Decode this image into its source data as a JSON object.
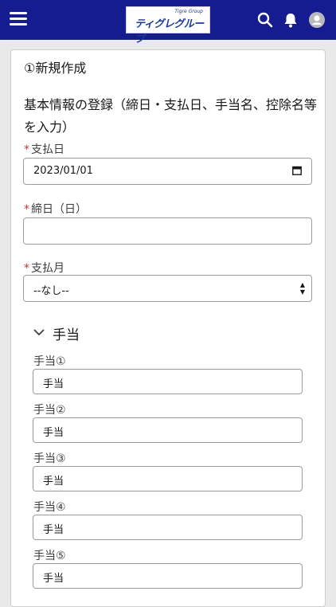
{
  "header": {
    "logo_tag": "Tigre Group",
    "logo_text": "ティグレグループ"
  },
  "form": {
    "step_title": "①新規作成",
    "description": "基本情報の登録（締日・支払日、手当名、控除名等を入力）",
    "required_mark": "*",
    "payment_date_label": "支払日",
    "payment_date_value": "2023/01/01",
    "closing_day_label": "締日（日）",
    "closing_day_value": "",
    "payment_month_label": "支払月",
    "payment_month_value": "--なし--"
  },
  "allowance_section": {
    "title": "手当",
    "items": [
      {
        "label": "手当①",
        "value": "手当"
      },
      {
        "label": "手当②",
        "value": "手当"
      },
      {
        "label": "手当③",
        "value": "手当"
      },
      {
        "label": "手当④",
        "value": "手当"
      },
      {
        "label": "手当⑤",
        "value": "手当"
      }
    ]
  },
  "icons": {
    "menu": "hamburger-menu-icon",
    "search": "search-icon",
    "notifications": "bell-icon",
    "user": "avatar-icon",
    "calendar": "calendar-icon",
    "select": "up-down-arrows-icon",
    "collapse": "chevron-down-icon"
  },
  "colors": {
    "header_bg": "#141c8f",
    "required": "#c23934"
  }
}
